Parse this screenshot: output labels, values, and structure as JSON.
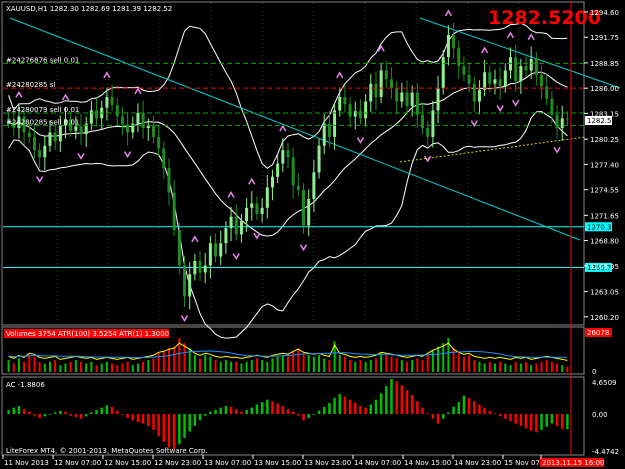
{
  "symbol_header": "XAUUSD,H1  1282.30 1282.69 1281.39 1282.52",
  "big_price": "1282.5200",
  "order_lines": [
    {
      "label": "#24276876 sell 0.01",
      "price": 1288.8,
      "color": "#00aa00"
    },
    {
      "label": "#24280285 sl",
      "price": 1286.0,
      "color": "#ff0000"
    },
    {
      "label": "#24280079 sell 0.01",
      "price": 1283.2,
      "color": "#00aa00"
    },
    {
      "label": "#24280285 sell 0.01",
      "price": 1281.8,
      "color": "#00aa00"
    }
  ],
  "horizontal_levels": [
    {
      "label": "1270.36",
      "price": 1270.36,
      "color": "#00ffff"
    },
    {
      "label": "1265.77",
      "price": 1265.77,
      "color": "#00ffff"
    }
  ],
  "current_price_label": "1282.52",
  "price_axis_ticks": [
    "1294.60",
    "1291.75",
    "1288.85",
    "1286.00",
    "1283.15",
    "1280.25",
    "1277.40",
    "1274.55",
    "1271.65",
    "1268.80",
    "1265.95",
    "1263.05",
    "1260.20"
  ],
  "time_axis_labels": [
    "11 Nov 2013",
    "12 Nov 07:00",
    "12 Nov 15:00",
    "12 Nov 23:00",
    "13 Nov 07:00",
    "13 Nov 15:00",
    "13 Nov 23:00",
    "14 Nov 07:00",
    "14 Nov 15:00",
    "14 Nov 23:00",
    "15 Nov 07:00",
    "2013.11.15 16:00"
  ],
  "volume_panel": {
    "title": "Volumes 3754  ATR(100) 3.5254  ATR(1) 1.3000",
    "max_label": "26078",
    "min_label": "0"
  },
  "ac_panel": {
    "title": "AC -1.8806",
    "max_label": "4.6509",
    "mid_label": "0.00",
    "min_label": "-4.4742"
  },
  "copyright": "LiteForex MT4, © 2001-2013, MetaQuotes Software Corp.",
  "colors": {
    "background": "#000000",
    "candle_up": "#90ee90",
    "candle_down": "#228b22",
    "bands": "#ffffff",
    "trendline": "#00ced1",
    "fractal": "#ee82ee",
    "volume_up": "#00c000",
    "volume_down": "#ff0000",
    "atr_fast": "#ffff00",
    "atr_slow": "#1e90ff",
    "ac_up": "#00c000",
    "ac_down": "#ff0000",
    "cutoff": "#ff0000"
  },
  "chart_data": {
    "type": "candlestick",
    "title": "XAUUSD,H1",
    "ylim": [
      1259.5,
      1295.5
    ],
    "closes": [
      1282.2,
      1281.5,
      1282.8,
      1281.0,
      1280.5,
      1279.0,
      1278.2,
      1279.5,
      1281.0,
      1280.0,
      1281.8,
      1282.5,
      1281.2,
      1281.7,
      1280.8,
      1282.0,
      1283.5,
      1282.6,
      1283.8,
      1285.0,
      1284.1,
      1282.8,
      1281.9,
      1281.0,
      1282.0,
      1283.2,
      1281.5,
      1281.8,
      1280.5,
      1279.2,
      1277.0,
      1274.2,
      1270.0,
      1266.0,
      1262.5,
      1265.0,
      1266.5,
      1265.2,
      1266.0,
      1268.5,
      1267.0,
      1268.5,
      1270.2,
      1271.5,
      1269.5,
      1271.0,
      1272.5,
      1273.0,
      1271.8,
      1272.5,
      1274.8,
      1276.0,
      1277.5,
      1279.0,
      1278.2,
      1275.0,
      1274.5,
      1270.5,
      1273.5,
      1276.5,
      1279.5,
      1282.0,
      1280.5,
      1283.5,
      1285.0,
      1284.2,
      1282.8,
      1283.4,
      1282.6,
      1284.5,
      1286.5,
      1285.0,
      1288.0,
      1287.0,
      1286.0,
      1284.5,
      1285.5,
      1284.0,
      1285.5,
      1283.0,
      1281.5,
      1280.5,
      1283.5,
      1286.0,
      1289.5,
      1292.0,
      1290.5,
      1288.5,
      1287.5,
      1286.5,
      1284.5,
      1285.8,
      1287.8,
      1286.5,
      1287.0,
      1286.2,
      1288.0,
      1289.5,
      1286.8,
      1288.5,
      1288.0,
      1289.3,
      1287.5,
      1286.2,
      1284.8,
      1283.0,
      1281.5,
      1282.6,
      1282.5
    ],
    "volume": [
      0.35,
      0.25,
      0.4,
      0.3,
      0.5,
      0.45,
      0.3,
      0.25,
      0.3,
      0.35,
      0.2,
      0.25,
      0.3,
      0.35,
      0.3,
      0.25,
      0.3,
      0.2,
      0.25,
      0.3,
      0.25,
      0.2,
      0.25,
      0.3,
      0.2,
      0.25,
      0.3,
      0.35,
      0.4,
      0.55,
      0.6,
      0.7,
      0.75,
      1.0,
      0.85,
      0.7,
      0.5,
      0.4,
      0.5,
      0.45,
      0.35,
      0.3,
      0.35,
      0.3,
      0.3,
      0.25,
      0.3,
      0.35,
      0.4,
      0.35,
      0.3,
      0.4,
      0.45,
      0.5,
      0.45,
      0.6,
      0.7,
      0.55,
      0.5,
      0.45,
      0.5,
      0.4,
      0.35,
      0.9,
      0.5,
      0.45,
      0.35,
      0.3,
      0.35,
      0.3,
      0.35,
      0.4,
      0.55,
      0.5,
      0.45,
      0.4,
      0.35,
      0.3,
      0.35,
      0.4,
      0.35,
      0.5,
      0.65,
      0.75,
      0.85,
      1.0,
      0.7,
      0.55,
      0.45,
      0.5,
      0.35,
      0.3,
      0.25,
      0.3,
      0.25,
      0.3,
      0.25,
      0.2,
      0.3,
      0.25,
      0.3,
      0.2,
      0.25,
      0.3,
      0.35,
      0.3,
      0.25,
      0.2,
      0.15
    ],
    "ac": [
      0.5,
      0.8,
      1.0,
      0.6,
      0.3,
      -0.2,
      -0.5,
      -0.3,
      -0.1,
      0.2,
      0.4,
      0.3,
      -0.2,
      -0.4,
      -0.6,
      -0.3,
      0.2,
      0.5,
      0.8,
      1.1,
      0.9,
      0.4,
      -0.1,
      -0.5,
      -0.8,
      -1.0,
      -1.2,
      -1.5,
      -2.0,
      -2.8,
      -3.5,
      -4.2,
      -4.4,
      -3.8,
      -3.0,
      -2.2,
      -1.5,
      -0.8,
      -0.2,
      0.3,
      0.5,
      0.8,
      1.0,
      0.9,
      0.6,
      0.3,
      0.5,
      0.8,
      1.2,
      1.5,
      1.8,
      1.6,
      1.3,
      1.0,
      0.6,
      0.3,
      -0.2,
      -0.8,
      -0.5,
      -0.1,
      0.4,
      0.9,
      1.4,
      2.0,
      2.5,
      2.2,
      1.8,
      1.4,
      1.0,
      0.8,
      1.2,
      1.8,
      2.6,
      3.5,
      4.4,
      4.1,
      3.6,
      3.0,
      2.4,
      1.6,
      0.8,
      0.1,
      -0.6,
      -1.2,
      -0.6,
      0.2,
      0.9,
      1.5,
      2.3,
      2.0,
      1.6,
      1.2,
      0.8,
      0.4,
      0.1,
      -0.3,
      -0.6,
      -0.9,
      -1.2,
      -1.5,
      -1.8,
      -2.1,
      -2.3,
      -2.0,
      -1.6,
      -1.2,
      -1.5,
      -1.9,
      -1.9
    ]
  }
}
